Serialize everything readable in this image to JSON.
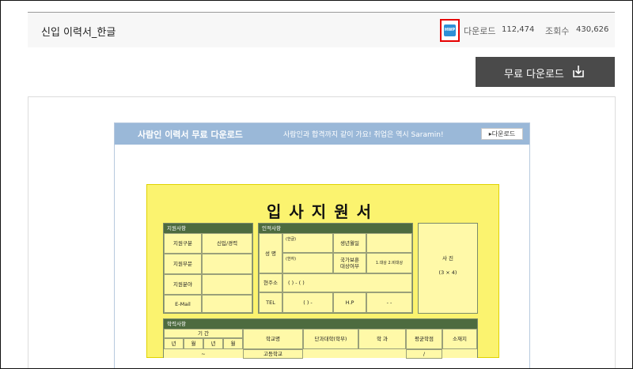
{
  "header": {
    "file_title": "신입 이력서_한글",
    "file_type_icon": "hwp-file-icon",
    "file_type_label": "HWP",
    "download_label": "다운로드",
    "download_count": "112,474",
    "views_label": "조회수",
    "views_count": "430,626"
  },
  "free_download_button": {
    "label": "무료 다운로드",
    "icon": "download-icon"
  },
  "preview": {
    "banner": {
      "title": "사람인 이력서 무료 다운로드",
      "subtitle": "사람인과 합격까지 같이 가요! 취업은 역시 Saramin!",
      "button": "▸다운로드"
    },
    "form": {
      "title": "입사지원서",
      "application": {
        "header": "지원사항",
        "rows": [
          {
            "label": "지원구분",
            "value": "신입/경력"
          },
          {
            "label": "지원부문",
            "value": ""
          },
          {
            "label": "지원분야",
            "value": ""
          },
          {
            "label": "E-Mail",
            "value": ""
          }
        ]
      },
      "personal": {
        "header": "인적사항",
        "name_label": "성 명",
        "korean_label": "(한글)",
        "hanja_label": "(한자)",
        "birth_label": "생년월일",
        "veteran_label": "국가보훈\n대상여부",
        "veteran_value": "1.대상 2.비대상",
        "address_label": "현주소",
        "address_value": "(   ) - (   )",
        "tel_label": "TEL",
        "tel_value": "(   )     -",
        "hp_label": "H.P",
        "hp_value": "-       -"
      },
      "photo": {
        "label": "사 진",
        "size": "(3 × 4)"
      },
      "education": {
        "header": "학력사항",
        "period_label": "기 간",
        "year": "년",
        "month": "월",
        "columns": [
          "학교명",
          "단과대학(학부)",
          "학 과",
          "평균학점",
          "소재지"
        ],
        "first_row_school": "고등학교",
        "dash": "~",
        "slash": "/"
      }
    }
  }
}
